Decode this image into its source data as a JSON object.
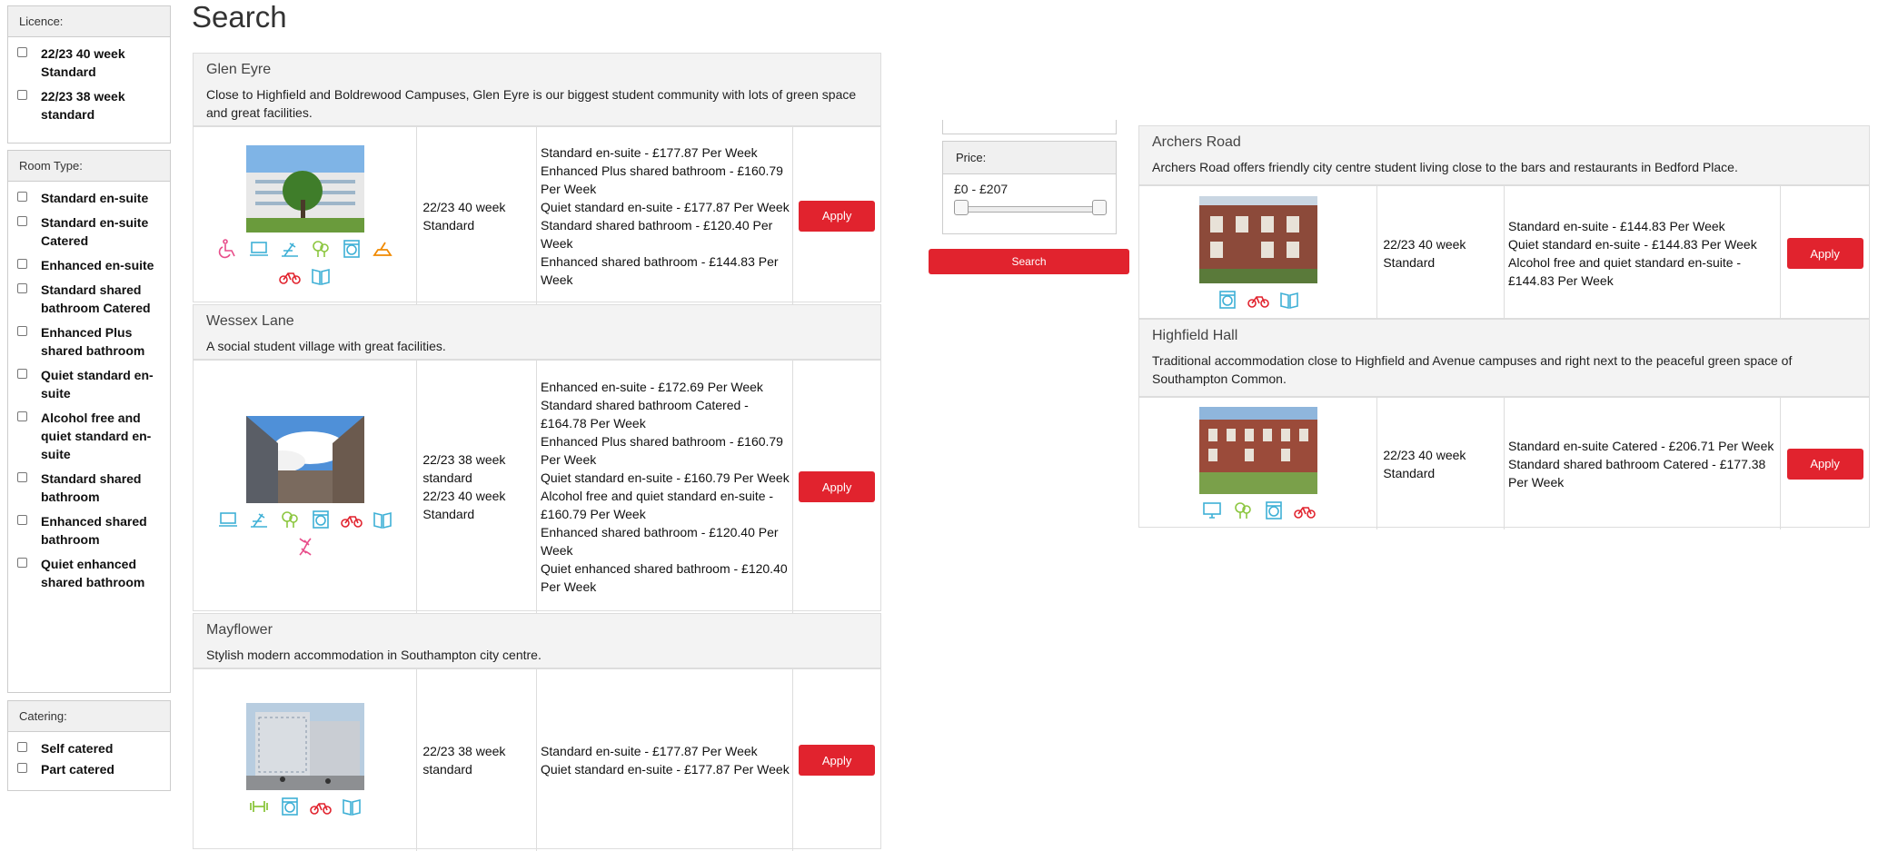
{
  "page": {
    "title": "Search"
  },
  "filters": {
    "licence": {
      "label": "Licence:",
      "options": [
        "22/23 40 week Standard",
        "22/23 38 week standard"
      ]
    },
    "room_type": {
      "label": "Room Type:",
      "options": [
        "Standard en-suite",
        "Standard en-suite Catered",
        "Enhanced en-suite",
        "Standard shared bathroom Catered",
        "Enhanced Plus shared bathroom",
        "Quiet standard en-suite",
        "Alcohol free and quiet standard en-suite",
        "Standard shared bathroom",
        "Enhanced shared bathroom",
        "Quiet enhanced shared bathroom"
      ]
    },
    "catering": {
      "label": "Catering:",
      "options": [
        "Self catered",
        "Part catered"
      ]
    },
    "price": {
      "label": "Price:",
      "range_text": "£0 - £207",
      "min_fraction": 0,
      "max_fraction": 1
    },
    "search_label": "Search"
  },
  "results": [
    {
      "name": "Glen Eyre",
      "description": "Close to Highfield and Boldrewood Campuses, Glen Eyre is our biggest student community with lots of green space and great facilities.",
      "licences": [
        "22/23 40 week Standard"
      ],
      "rooms": [
        "Standard en-suite - £177.87 Per Week",
        "Enhanced Plus shared bathroom - £160.79 Per Week",
        "Quiet standard en-suite - £177.87 Per Week",
        "Standard shared bathroom - £120.40 Per Week",
        "Enhanced shared bathroom - £144.83 Per Week"
      ],
      "icons": [
        "accessible-chair-icon",
        "laptop-icon",
        "study-desk-icon",
        "tree-icon",
        "laundry-icon",
        "kitchen-icon",
        "bicycle-icon",
        "book-icon"
      ],
      "apply_label": "Apply"
    },
    {
      "name": "Wessex Lane",
      "description": "A social student village with great facilities.",
      "licences": [
        "22/23 38 week standard",
        "22/23 40 week Standard"
      ],
      "rooms": [
        "Enhanced en-suite - £172.69 Per Week",
        "Standard shared bathroom Catered - £164.78 Per Week",
        "Enhanced Plus shared bathroom - £160.79 Per Week",
        "Quiet standard en-suite - £160.79 Per Week",
        "Alcohol free and quiet standard en-suite - £160.79 Per Week",
        "Enhanced shared bathroom - £120.40 Per Week",
        "Quiet enhanced shared bathroom - £120.40 Per Week"
      ],
      "icons": [
        "laptop-icon",
        "study-desk-icon",
        "tree-icon",
        "laundry-icon",
        "bicycle-icon",
        "book-icon",
        "dna-icon"
      ],
      "apply_label": "Apply"
    },
    {
      "name": "Mayflower",
      "description": "Stylish modern accommodation in Southampton city centre.",
      "licences": [
        "22/23 38 week standard"
      ],
      "rooms": [
        "Standard en-suite - £177.87 Per Week",
        "Quiet standard en-suite - £177.87 Per Week"
      ],
      "icons": [
        "gym-icon",
        "laundry-icon",
        "bicycle-icon",
        "book-icon"
      ],
      "apply_label": "Apply"
    },
    {
      "name": "Archers Road",
      "description": "Archers Road offers friendly city centre student living close to the bars and restaurants in Bedford Place.",
      "licences": [
        "22/23 40 week Standard"
      ],
      "rooms": [
        "Standard en-suite - £144.83 Per Week",
        "Quiet standard en-suite - £144.83 Per Week",
        "Alcohol free and quiet standard en-suite - £144.83 Per Week"
      ],
      "icons": [
        "laundry-icon",
        "bicycle-icon",
        "book-icon"
      ],
      "apply_label": "Apply"
    },
    {
      "name": "Highfield Hall",
      "description": "Traditional accommodation close to Highfield and Avenue campuses and right next to the peaceful green space of Southampton Common.",
      "licences": [
        "22/23 40 week Standard"
      ],
      "rooms": [
        "Standard en-suite Catered - £206.71 Per Week",
        "Standard shared bathroom Catered - £177.38 Per Week"
      ],
      "icons": [
        "monitor-icon",
        "tree-icon",
        "laundry-icon",
        "bicycle-icon"
      ],
      "apply_label": "Apply"
    }
  ],
  "colors": {
    "accent_red": "#e1232e",
    "icon_pink": "#e84d8a",
    "icon_blue": "#3fb0d6",
    "icon_green": "#8cc63f",
    "icon_orange": "#f18a00",
    "icon_red": "#e1232e"
  }
}
